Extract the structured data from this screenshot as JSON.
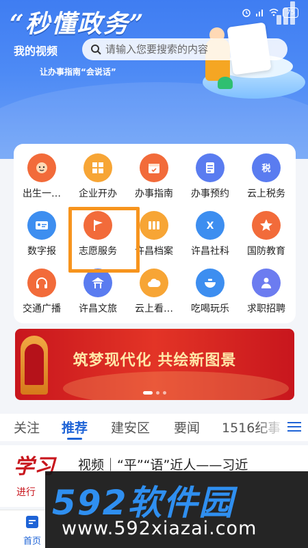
{
  "status_bar": {
    "battery": "75"
  },
  "hero": {
    "title": "“秒懂政务”",
    "search_prefix": "我的视频",
    "search_placeholder": "请输入您要搜索的内容",
    "slogan": "让办事指南“会说话”"
  },
  "services": [
    {
      "label": "出生一…",
      "icon": "baby-face-icon",
      "color": "#f26b3a"
    },
    {
      "label": "企业开办",
      "icon": "grid-squares-icon",
      "color": "#f7a535"
    },
    {
      "label": "办事指南",
      "icon": "calendar-icon",
      "color": "#f26b3a"
    },
    {
      "label": "办事预约",
      "icon": "document-icon",
      "color": "#5a7cf0"
    },
    {
      "label": "云上税务",
      "icon": "tax-icon",
      "color": "#5a7cf0"
    },
    {
      "label": "数字报",
      "icon": "id-card-icon",
      "color": "#3d8ef0"
    },
    {
      "label": "志愿服务",
      "icon": "flag-icon",
      "color": "#f26b3a"
    },
    {
      "label": "许昌档案",
      "icon": "archive-icon",
      "color": "#f7a535"
    },
    {
      "label": "许昌社科",
      "icon": "social-science-icon",
      "color": "#3d8ef0"
    },
    {
      "label": "国防教育",
      "icon": "star-icon",
      "color": "#f26b3a"
    },
    {
      "label": "交通广播",
      "icon": "headphones-icon",
      "color": "#f26b3a"
    },
    {
      "label": "许昌文旅",
      "icon": "pavilion-icon",
      "color": "#5a7cf0"
    },
    {
      "label": "云上看…",
      "icon": "cloud-icon",
      "color": "#f7a535"
    },
    {
      "label": "吃喝玩乐",
      "icon": "bowl-icon",
      "color": "#3d8ef0"
    },
    {
      "label": "求职招聘",
      "icon": "person-icon",
      "color": "#6c7cf0"
    }
  ],
  "banner": {
    "text": "筑梦现代化 共绘新图景",
    "page_count": 3,
    "active_page": 1
  },
  "tabs": [
    {
      "label": "关注",
      "active": false
    },
    {
      "label": "推荐",
      "active": true
    },
    {
      "label": "建安区",
      "active": false
    },
    {
      "label": "要闻",
      "active": false
    },
    {
      "label": "1516纪事",
      "active": false
    }
  ],
  "news": {
    "logo_text": "学习",
    "logo_sub": "进行",
    "title": "视频｜“平”“语”近人——习近"
  },
  "bottom_nav": {
    "home_label": "首页"
  },
  "watermark": {
    "brand": "592软件园",
    "url": "www.592xiazai.com"
  },
  "colors": {
    "primary_blue": "#1e63d6",
    "hero_blue": "#4d8af5",
    "highlight_orange": "#f7941d",
    "banner_red": "#c8161d"
  }
}
